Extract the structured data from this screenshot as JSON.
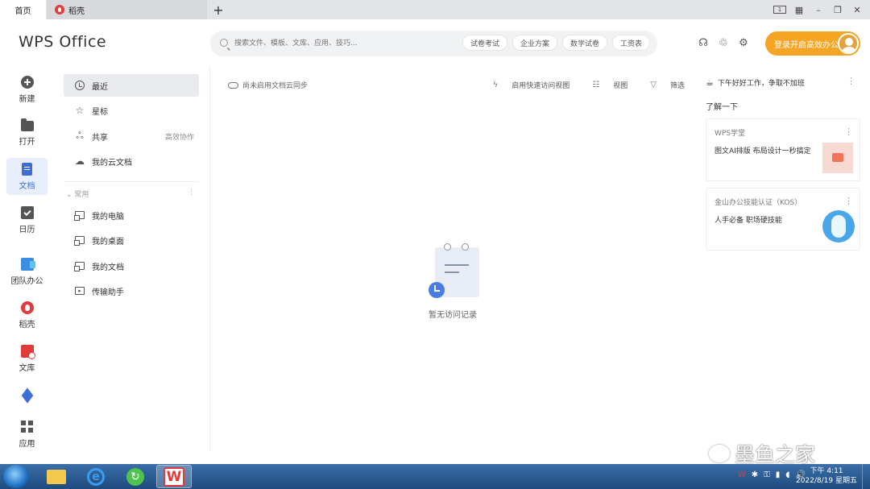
{
  "tabs": {
    "home": "首页",
    "daoke": "稻壳",
    "new_tab": "+"
  },
  "window_controls": {
    "layout": "1",
    "grid": "▦",
    "minimize": "–",
    "restore": "❐",
    "close": "✕"
  },
  "header": {
    "brand": "WPS Office",
    "search_placeholder": "搜索文件、模板、文库、应用、技巧...",
    "chips": [
      "试卷考试",
      "企业方案",
      "数学试卷",
      "工资表"
    ],
    "login_label": "登录开启高效办公"
  },
  "rail": {
    "items": [
      {
        "label": "新建",
        "icon": "new-icon"
      },
      {
        "label": "打开",
        "icon": "folder-icon"
      },
      {
        "label": "文档",
        "icon": "document-icon"
      },
      {
        "label": "日历",
        "icon": "calendar-icon"
      },
      {
        "label": "团队办公",
        "icon": "team-icon"
      },
      {
        "label": "稻壳",
        "icon": "daoke-icon"
      },
      {
        "label": "文库",
        "icon": "library-icon"
      },
      {
        "label": "",
        "icon": "cube-icon"
      },
      {
        "label": "应用",
        "icon": "apps-icon"
      }
    ]
  },
  "nav": {
    "recent": "最近",
    "starred": "星标",
    "shared": "共享",
    "shared_extra": "高效协作",
    "cloud_docs": "我的云文档",
    "group": "常用",
    "my_computer": "我的电脑",
    "my_desktop": "我的桌面",
    "my_documents": "我的文档",
    "transfer": "传输助手"
  },
  "main": {
    "cloud_tip": "尚未启用文档云同步",
    "quick_view": "启用快速访问视图",
    "view": "视图",
    "filter": "筛选",
    "empty_text": "暂无访问记录"
  },
  "right_panel": {
    "greeting": "下午好好工作，争取不加班",
    "learn": "了解一下",
    "cards": [
      {
        "title": "WPS学堂",
        "desc": "图文AI排版 布局设计一秒搞定"
      },
      {
        "title": "金山办公技能认证（KOS）",
        "desc": "人手必备 职场硬技能"
      }
    ]
  },
  "watermark": "墨鱼之家",
  "taskbar": {
    "tray": [
      "W",
      "✱",
      "⚿",
      "▮",
      "◖",
      "🔊"
    ],
    "time": "下午 4:11",
    "date": "2022/8/19 星期五"
  },
  "colors": {
    "accent": "#3b6fd7",
    "login": "#f5a524",
    "taskbar": "#2a5b94"
  }
}
